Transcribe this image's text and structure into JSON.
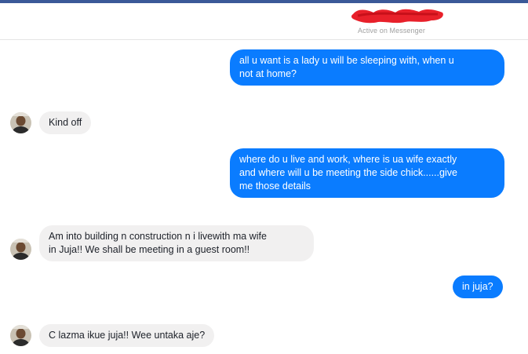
{
  "header": {
    "status": "Active on Messenger"
  },
  "messages": [
    {
      "direction": "sent",
      "text": "all u want is a lady u will be sleeping with, when u\nnot at home?"
    },
    {
      "direction": "received",
      "text": "Kind off"
    },
    {
      "direction": "sent",
      "text": "where do u live and work, where is ua wife exactly\nand where will u be meeting the side chick......give\nme those details"
    },
    {
      "direction": "received",
      "text": "Am into building n construction n i livewith ma wife\nin Juja!! We shall be meeting in a guest room!!"
    },
    {
      "direction": "sent",
      "text": "in juja?"
    },
    {
      "direction": "received",
      "text": "C lazma ikue juja!! Wee untaka aje?"
    }
  ],
  "colors": {
    "sent_bubble": "#0a7cff",
    "received_bubble": "#f1f0f0",
    "redaction": "#e8202a",
    "top_strip": "#3b5998"
  },
  "icons": {
    "avatar": "contact-avatar-icon"
  }
}
